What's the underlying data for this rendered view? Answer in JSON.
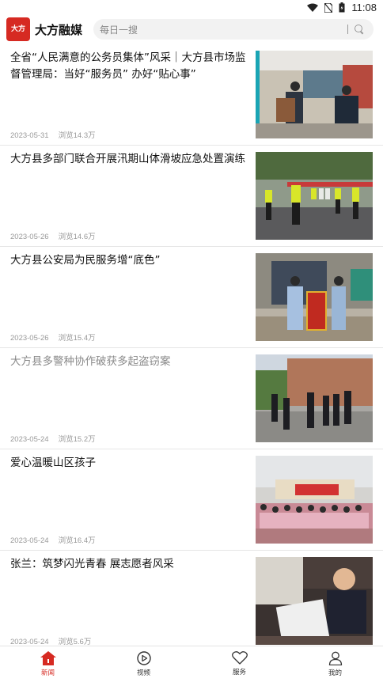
{
  "status_bar": {
    "time": "11:08"
  },
  "header": {
    "logo_text": "大方",
    "app_title": "大方融媒",
    "search_placeholder": "每日一搜"
  },
  "news": [
    {
      "title": "全省“人民满意的公务员集体”风采｜大方县市场监督管理局：当好“服务员” 办好“贴心事”",
      "date": "2023-05-31",
      "views": "浏览14.3万",
      "read": false
    },
    {
      "title": "大方县多部门联合开展汛期山体滑坡应急处置演练",
      "date": "2023-05-26",
      "views": "浏览14.6万",
      "read": false
    },
    {
      "title": "大方县公安局为民服务增“底色”",
      "date": "2023-05-26",
      "views": "浏览15.4万",
      "read": false
    },
    {
      "title": "大方县多警种协作破获多起盗窃案",
      "date": "2023-05-24",
      "views": "浏览15.2万",
      "read": true
    },
    {
      "title": "爱心温暖山区孩子",
      "date": "2023-05-24",
      "views": "浏览16.4万",
      "read": false
    },
    {
      "title": "张兰：筑梦闪光青春 展志愿者风采",
      "date": "2023-05-24",
      "views": "浏览5.6万",
      "read": false
    }
  ],
  "nav": {
    "tabs": [
      {
        "label": "新闻",
        "icon": "home-icon",
        "active": true
      },
      {
        "label": "视频",
        "icon": "play-circle-icon",
        "active": false
      },
      {
        "label": "服务",
        "icon": "heart-icon",
        "active": false
      },
      {
        "label": "我的",
        "icon": "user-icon",
        "active": false
      }
    ]
  },
  "colors": {
    "accent": "#d62a22"
  }
}
